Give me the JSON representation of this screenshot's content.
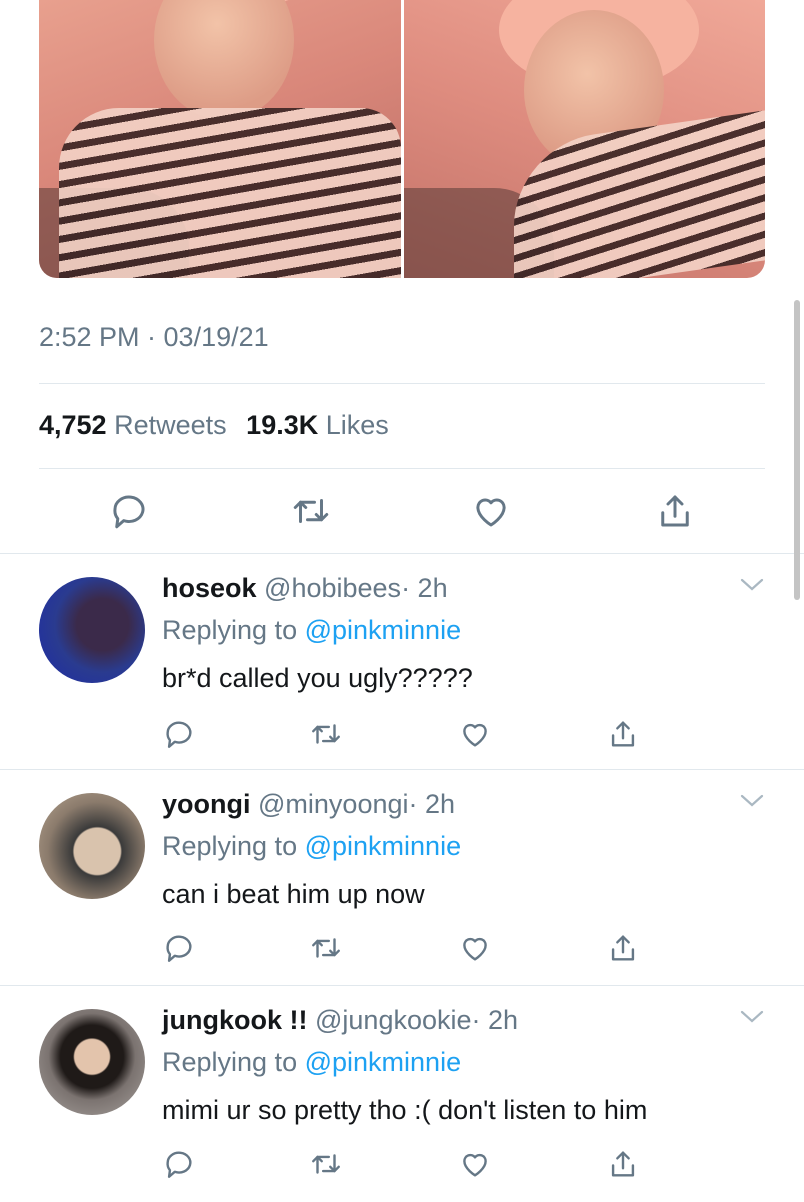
{
  "tweet": {
    "timestamp": "2:52 PM · 03/19/21",
    "retweets_count": "4,752",
    "retweets_label": "Retweets",
    "likes_count": "19.3K",
    "likes_label": "Likes"
  },
  "replies": [
    {
      "name": "hoseok",
      "handle": "@hobibees",
      "time": "· 2h",
      "replying_prefix": "Replying to",
      "replying_to": "@pinkminnie",
      "text": "br*d called you ugly?????"
    },
    {
      "name": "yoongi",
      "handle": "@minyoongi",
      "time": "· 2h",
      "replying_prefix": "Replying to",
      "replying_to": "@pinkminnie",
      "text": "can i beat him up now"
    },
    {
      "name": "jungkook !!",
      "handle": "@jungkookie",
      "time": "· 2h",
      "replying_prefix": "Replying to",
      "replying_to": "@pinkminnie",
      "text": "mimi ur so pretty tho :( don't listen to him"
    }
  ],
  "icons": {
    "reply": "reply-icon",
    "retweet": "retweet-icon",
    "like": "heart-icon",
    "share": "share-icon",
    "more": "chevron-down-icon"
  },
  "colors": {
    "text_primary": "#14171a",
    "text_secondary": "#657786",
    "link": "#1da1f2",
    "divider": "#e1e8ed"
  }
}
